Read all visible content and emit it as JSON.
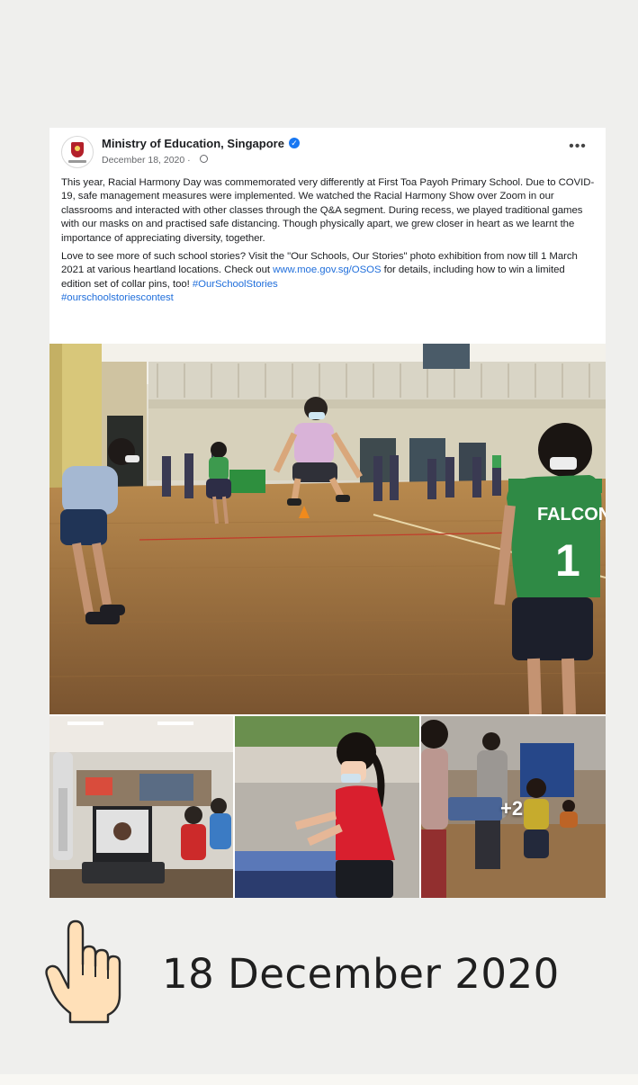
{
  "post": {
    "page_name": "Ministry of Education, Singapore",
    "date": "December 18, 2020 ·",
    "more_label": "•••",
    "paragraph_1": "This year, Racial Harmony Day was commemorated very differently at First Toa Payoh Primary School. Due to COVID-19, safe management measures were implemented. We watched the Racial Harmony Show over Zoom in our classrooms and interacted with other classes through the Q&A segment. During recess, we played traditional games with our masks on and practised safe distancing. Though physically apart, we grew closer in heart as we learnt the importance of appreciating diversity, together.",
    "paragraph_2_start": "Love to see more of such school stories? Visit the \"Our Schools, Our Stories\" photo exhibition from now till 1 March 2021 at various heartland locations. Check out ",
    "link_url": "www.moe.gov.sg/OSOS",
    "paragraph_2_mid": " for details, including how to win a limited edition set of collar pins, too! ",
    "hashtag_1": "#OurSchoolStories",
    "hashtag_2": "#ourschoolstoriescontest",
    "extra_photos": "+2",
    "jersey_text": "FALCON",
    "jersey_number": "1"
  },
  "caption": {
    "date": "18 December 2020",
    "icon": "pointing-hand-icon"
  },
  "colors": {
    "background": "#efefed",
    "link": "#216fdb",
    "verified": "#1877f2",
    "hand_fill": "#ffe0b8"
  }
}
